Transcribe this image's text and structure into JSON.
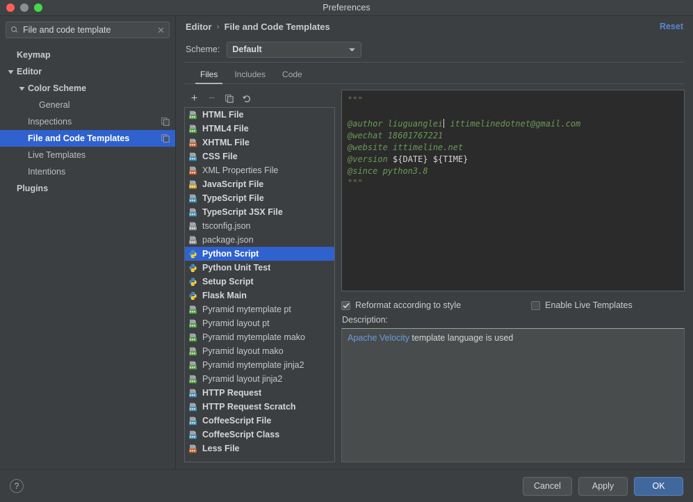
{
  "window": {
    "title": "Preferences",
    "traffic_lights": [
      "close-button",
      "minimize-button",
      "zoom-button"
    ]
  },
  "sidebar": {
    "search": {
      "value": "File and code template",
      "placeholder": "Search settings",
      "icon": "search-icon",
      "clear_icon": "clear-icon"
    },
    "items": [
      {
        "label": "Keymap",
        "indent": 0,
        "bold": true,
        "twisty": "",
        "selected": false,
        "trailing_icon": ""
      },
      {
        "label": "Editor",
        "indent": 0,
        "bold": true,
        "twisty": "expanded",
        "selected": false,
        "trailing_icon": ""
      },
      {
        "label": "Color Scheme",
        "indent": 1,
        "bold": true,
        "twisty": "expanded",
        "selected": false,
        "trailing_icon": ""
      },
      {
        "label": "General",
        "indent": 2,
        "bold": false,
        "twisty": "",
        "selected": false,
        "trailing_icon": ""
      },
      {
        "label": "Inspections",
        "indent": 1,
        "bold": false,
        "twisty": "",
        "selected": false,
        "trailing_icon": "copy-icon"
      },
      {
        "label": "File and Code Templates",
        "indent": 1,
        "bold": true,
        "twisty": "",
        "selected": true,
        "trailing_icon": "copy-icon"
      },
      {
        "label": "Live Templates",
        "indent": 1,
        "bold": false,
        "twisty": "",
        "selected": false,
        "trailing_icon": ""
      },
      {
        "label": "Intentions",
        "indent": 1,
        "bold": false,
        "twisty": "",
        "selected": false,
        "trailing_icon": ""
      },
      {
        "label": "Plugins",
        "indent": 0,
        "bold": true,
        "twisty": "",
        "selected": false,
        "trailing_icon": ""
      }
    ]
  },
  "main": {
    "breadcrumb": {
      "root": "Editor",
      "separator": "›",
      "current": "File and Code Templates"
    },
    "reset_label": "Reset",
    "scheme": {
      "label": "Scheme:",
      "value": "Default",
      "caret_icon": "chevron-down-icon"
    },
    "tabs": [
      {
        "label": "Files",
        "active": true
      },
      {
        "label": "Includes",
        "active": false
      },
      {
        "label": "Code",
        "active": false
      }
    ],
    "list_toolbar": [
      {
        "name": "add-template-button",
        "glyph": "+",
        "enabled": true
      },
      {
        "name": "remove-template-button",
        "glyph": "−",
        "enabled": false
      },
      {
        "name": "copy-template-button",
        "glyph": "copy-icon",
        "enabled": true
      },
      {
        "name": "reset-template-button",
        "glyph": "revert-icon",
        "enabled": true
      }
    ],
    "templates": [
      {
        "name": "HTML File",
        "bold": true,
        "selected": false,
        "icon_color": "#4f9c40"
      },
      {
        "name": "HTML4 File",
        "bold": true,
        "selected": false,
        "icon_color": "#4f9c40"
      },
      {
        "name": "XHTML File",
        "bold": true,
        "selected": false,
        "icon_color": "#c55a29"
      },
      {
        "name": "CSS File",
        "bold": true,
        "selected": false,
        "icon_color": "#3f8fb5"
      },
      {
        "name": "XML Properties File",
        "bold": false,
        "selected": false,
        "icon_color": "#c55a29"
      },
      {
        "name": "JavaScript File",
        "bold": true,
        "selected": false,
        "icon_color": "#c9a227"
      },
      {
        "name": "TypeScript File",
        "bold": true,
        "selected": false,
        "icon_color": "#3f8fb5"
      },
      {
        "name": "TypeScript JSX File",
        "bold": true,
        "selected": false,
        "icon_color": "#3f8fb5"
      },
      {
        "name": "tsconfig.json",
        "bold": false,
        "selected": false,
        "icon_color": "#8b8f91"
      },
      {
        "name": "package.json",
        "bold": false,
        "selected": false,
        "icon_color": "#8b8f91"
      },
      {
        "name": "Python Script",
        "bold": true,
        "selected": true,
        "icon_color": "#4f9c40"
      },
      {
        "name": "Python Unit Test",
        "bold": true,
        "selected": false,
        "icon_color": "#4f9c40"
      },
      {
        "name": "Setup Script",
        "bold": true,
        "selected": false,
        "icon_color": "#4f9c40"
      },
      {
        "name": "Flask Main",
        "bold": true,
        "selected": false,
        "icon_color": "#4f9c40"
      },
      {
        "name": "Pyramid mytemplate pt",
        "bold": false,
        "selected": false,
        "icon_color": "#4f9c40"
      },
      {
        "name": "Pyramid layout pt",
        "bold": false,
        "selected": false,
        "icon_color": "#4f9c40"
      },
      {
        "name": "Pyramid mytemplate mako",
        "bold": false,
        "selected": false,
        "icon_color": "#4f9c40"
      },
      {
        "name": "Pyramid layout mako",
        "bold": false,
        "selected": false,
        "icon_color": "#4f9c40"
      },
      {
        "name": "Pyramid mytemplate jinja2",
        "bold": false,
        "selected": false,
        "icon_color": "#4f9c40"
      },
      {
        "name": "Pyramid layout jinja2",
        "bold": false,
        "selected": false,
        "icon_color": "#4f9c40"
      },
      {
        "name": "HTTP Request",
        "bold": true,
        "selected": false,
        "icon_color": "#3f8fb5"
      },
      {
        "name": "HTTP Request Scratch",
        "bold": true,
        "selected": false,
        "icon_color": "#3f8fb5"
      },
      {
        "name": "CoffeeScript File",
        "bold": true,
        "selected": false,
        "icon_color": "#3f8fb5"
      },
      {
        "name": "CoffeeScript Class",
        "bold": true,
        "selected": false,
        "icon_color": "#3f8fb5"
      },
      {
        "name": "Less File",
        "bold": true,
        "selected": false,
        "icon_color": "#c55a29"
      }
    ],
    "editor": {
      "lines": [
        {
          "segments": [
            {
              "text": "\"\"\"",
              "style": "doc"
            }
          ]
        },
        {
          "segments": []
        },
        {
          "segments": [
            {
              "text": "@author liuguanglei",
              "style": "green"
            },
            {
              "text": "|",
              "style": "caret"
            },
            {
              "text": " ittimelinedotnet@gmail.com",
              "style": "green"
            }
          ]
        },
        {
          "segments": [
            {
              "text": "@wechat 18601767221",
              "style": "green"
            }
          ]
        },
        {
          "segments": [
            {
              "text": "@website ittimeline.net",
              "style": "green"
            }
          ]
        },
        {
          "segments": [
            {
              "text": "@version ",
              "style": "green"
            },
            {
              "text": "${DATE} ${TIME}",
              "style": "var"
            }
          ]
        },
        {
          "segments": [
            {
              "text": "@since python3.8",
              "style": "green"
            }
          ]
        },
        {
          "segments": [
            {
              "text": "\"\"\"",
              "style": "doc"
            }
          ]
        }
      ]
    },
    "options": [
      {
        "label": "Reformat according to style",
        "checked": true
      },
      {
        "label": "Enable Live Templates",
        "checked": false
      }
    ],
    "description": {
      "label": "Description:",
      "link_text": "Apache Velocity",
      "rest_text": " template language is used"
    }
  },
  "footer": {
    "help_glyph": "?",
    "buttons": [
      {
        "label": "Cancel",
        "primary": false
      },
      {
        "label": "Apply",
        "primary": false
      },
      {
        "label": "OK",
        "primary": true
      }
    ]
  },
  "colors": {
    "accent_selection": "#2f62cf",
    "link": "#5786d8",
    "primary_button": "#41689e",
    "editor_bg": "#2b2b2b",
    "panel_bg": "#3c3f41",
    "code_green": "#6a9955"
  }
}
